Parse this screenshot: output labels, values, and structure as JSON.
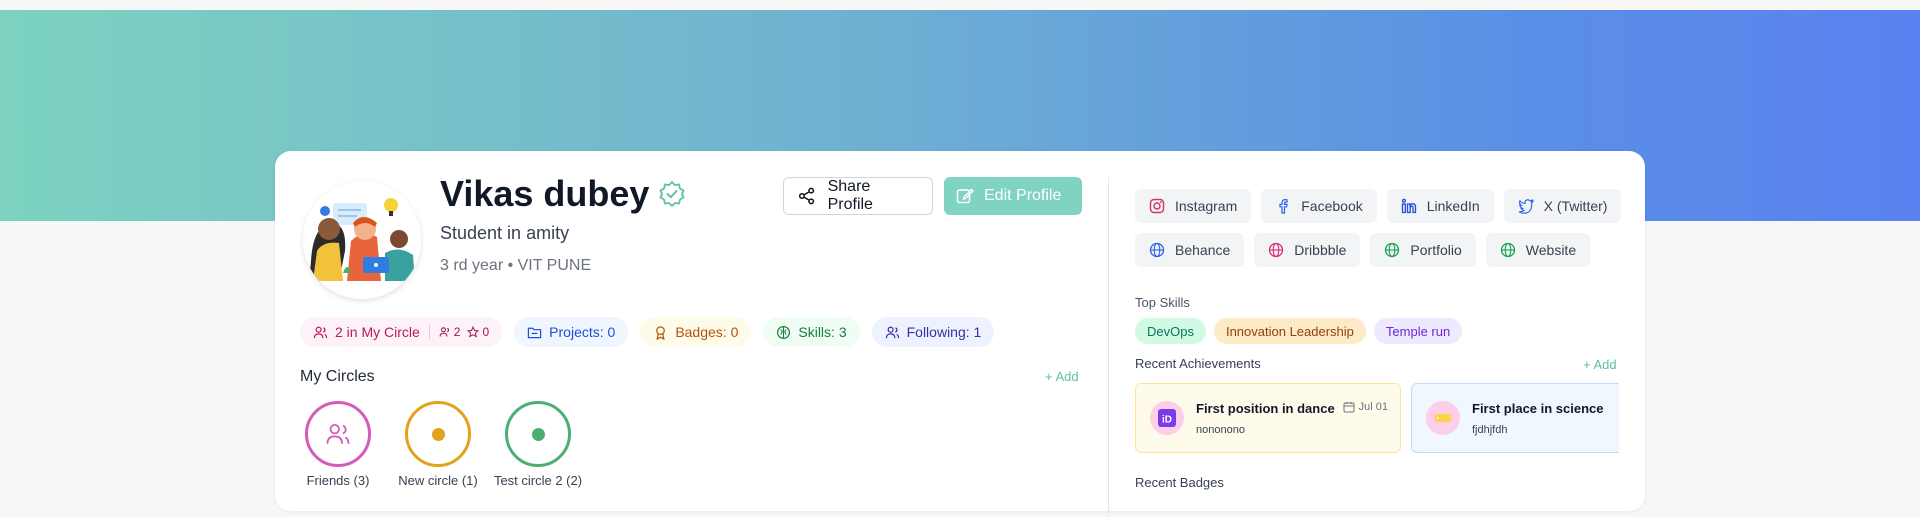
{
  "profile": {
    "name": "Vikas dubey",
    "headline": "Student in amity",
    "subline": "3 rd year • VIT PUNE"
  },
  "actions": {
    "share_label": "Share Profile",
    "edit_label": "Edit Profile"
  },
  "stats": {
    "circle_label": "2 in My Circle",
    "circle_people": "2",
    "circle_stars": "0",
    "projects": "Projects: 0",
    "badges": "Badges: 0",
    "skills": "Skills: 3",
    "following": "Following: 1"
  },
  "circles": {
    "title": "My Circles",
    "add": "+ Add",
    "items": [
      {
        "label": "Friends (3)",
        "color": "#d45bb8",
        "icon": "users-icon"
      },
      {
        "label": "New circle (1)",
        "color": "#e3a21a",
        "icon": "dot-icon"
      },
      {
        "label": "Test circle 2 (2)",
        "color": "#4caf72",
        "icon": "dot-icon"
      }
    ]
  },
  "socials": [
    {
      "label": "Instagram",
      "icon": "instagram-icon"
    },
    {
      "label": "Facebook",
      "icon": "facebook-icon"
    },
    {
      "label": "LinkedIn",
      "icon": "linkedin-icon"
    },
    {
      "label": "X (Twitter)",
      "icon": "twitter-icon"
    },
    {
      "label": "Behance",
      "icon": "globe-icon"
    },
    {
      "label": "Dribbble",
      "icon": "globe-icon"
    },
    {
      "label": "Portfolio",
      "icon": "globe-icon"
    },
    {
      "label": "Website",
      "icon": "globe-icon"
    }
  ],
  "top_skills": {
    "title": "Top Skills",
    "items": [
      "DevOps",
      "Innovation Leadership",
      "Temple run"
    ]
  },
  "achievements": {
    "title": "Recent Achievements",
    "add": "+ Add",
    "items": [
      {
        "title": "First position in dance",
        "date": "Jul 01",
        "desc": "nononono"
      },
      {
        "title": "First place in science",
        "date": "",
        "desc": "fjdhjfdh"
      }
    ]
  },
  "badges": {
    "title": "Recent Badges"
  },
  "colors": {
    "accent": "#7fd3c0",
    "banner_start": "#7dd3c0",
    "banner_end": "#5a82f0"
  }
}
